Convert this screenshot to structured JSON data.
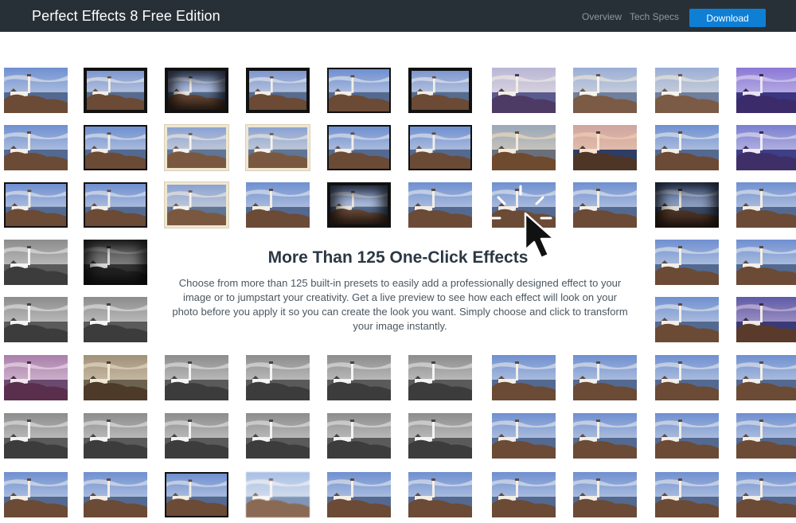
{
  "header": {
    "title": "Perfect Effects 8 Free Edition",
    "nav": [
      "Overview",
      "Tech Specs"
    ],
    "download_label": "Download"
  },
  "hero": {
    "heading": "More Than 125 One-Click Effects",
    "body": "Choose from more than 125 built-in presets to easily add a professionally designed effect to your image or to jumpstart your creativity. Get a live preview to see how each effect will look on your photo before you apply it so you can create the look you want. Simply choose and click to transform your image instantly."
  },
  "grid": {
    "rows": [
      [
        "natural",
        "frame-thick",
        "frame-dark",
        "frame-thick",
        "frame-black",
        "frame-thick",
        "purple-fade",
        "natural-soft",
        "natural-soft",
        "violet"
      ],
      [
        "natural",
        "frame-black",
        "frame-cream",
        "frame-cream",
        "frame-black",
        "frame-black",
        "warm-sepia",
        "orange-glow",
        "natural",
        "violet-glitch"
      ],
      [
        "frame-black",
        "frame-black",
        "frame-cream",
        "natural",
        "frame-dark",
        "natural",
        "natural",
        "natural",
        "dark-vignette",
        "natural"
      ],
      [
        "bw",
        "bw-dark",
        "",
        "",
        "",
        "",
        "",
        "",
        "natural",
        "natural"
      ],
      [
        "bw",
        "bw",
        "",
        "",
        "",
        "",
        "",
        "",
        "natural",
        "violet-warm"
      ],
      [
        "magenta",
        "sepia",
        "bw",
        "bw",
        "bw",
        "bw",
        "natural",
        "natural",
        "natural",
        "natural"
      ],
      [
        "bw",
        "bw",
        "bw",
        "bw",
        "bw",
        "bw",
        "natural",
        "natural",
        "natural",
        "natural"
      ],
      [
        "natural",
        "natural",
        "frame-black",
        "faded",
        "natural",
        "natural",
        "natural",
        "natural",
        "natural",
        "natural"
      ]
    ]
  },
  "colors": {
    "header_bg": "#283037",
    "accent": "#0f7fd6",
    "heading": "#2b3744",
    "body": "#4a5660"
  },
  "icons": {
    "cursor": "click-cursor-icon"
  }
}
